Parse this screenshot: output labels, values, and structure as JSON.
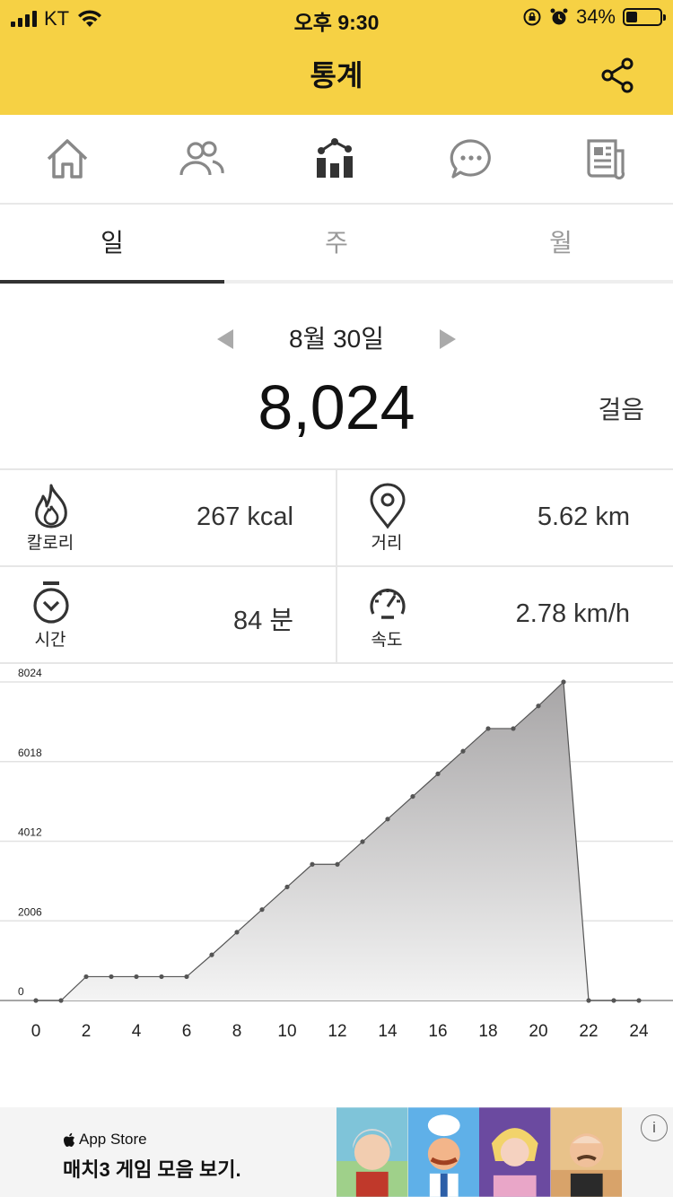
{
  "status_bar": {
    "carrier": "KT",
    "time": "오후 9:30",
    "battery": "34%",
    "battery_level": 0.34
  },
  "header": {
    "title": "통계"
  },
  "nav": {
    "items": [
      "home-icon",
      "friends-icon",
      "statistics-icon",
      "chat-icon",
      "news-icon"
    ],
    "active_index": 2
  },
  "tabs": {
    "items": [
      "일",
      "주",
      "월"
    ],
    "active_index": 0
  },
  "summary": {
    "date": "8월 30일",
    "steps": "8,024",
    "steps_unit": "걸음"
  },
  "stats": {
    "calories": {
      "label": "칼로리",
      "value": "267 kcal"
    },
    "distance": {
      "label": "거리",
      "value": "5.62 km"
    },
    "time": {
      "label": "시간",
      "value": "84 분"
    },
    "speed": {
      "label": "속도",
      "value": "2.78 km/h"
    }
  },
  "colors": {
    "header": "#f6d144",
    "chart_fill_top": "#a7a5a6",
    "chart_fill_bottom": "#f4f4f4",
    "chart_line": "#555555"
  },
  "chart_data": {
    "type": "area",
    "x": [
      0,
      1,
      2,
      3,
      4,
      5,
      6,
      7,
      8,
      9,
      10,
      11,
      12,
      13,
      14,
      15,
      16,
      17,
      18,
      19,
      20,
      21,
      22,
      23,
      24
    ],
    "y": [
      0,
      0,
      600,
      600,
      600,
      600,
      600,
      1150,
      1720,
      2290,
      2860,
      3430,
      3430,
      4000,
      4570,
      5140,
      5710,
      6280,
      6850,
      6850,
      7420,
      8024,
      0,
      0,
      0
    ],
    "x_ticks": [
      "0",
      "2",
      "4",
      "6",
      "8",
      "10",
      "12",
      "14",
      "16",
      "18",
      "20",
      "22",
      "24"
    ],
    "y_ticks": [
      "0",
      "2006",
      "4012",
      "6018",
      "8024"
    ],
    "ylim": [
      0,
      8024
    ],
    "xlim": [
      0,
      24
    ],
    "grid": true
  },
  "ad": {
    "store": "App Store",
    "headline": "매치3 게임 모음 보기.",
    "info": "i"
  }
}
